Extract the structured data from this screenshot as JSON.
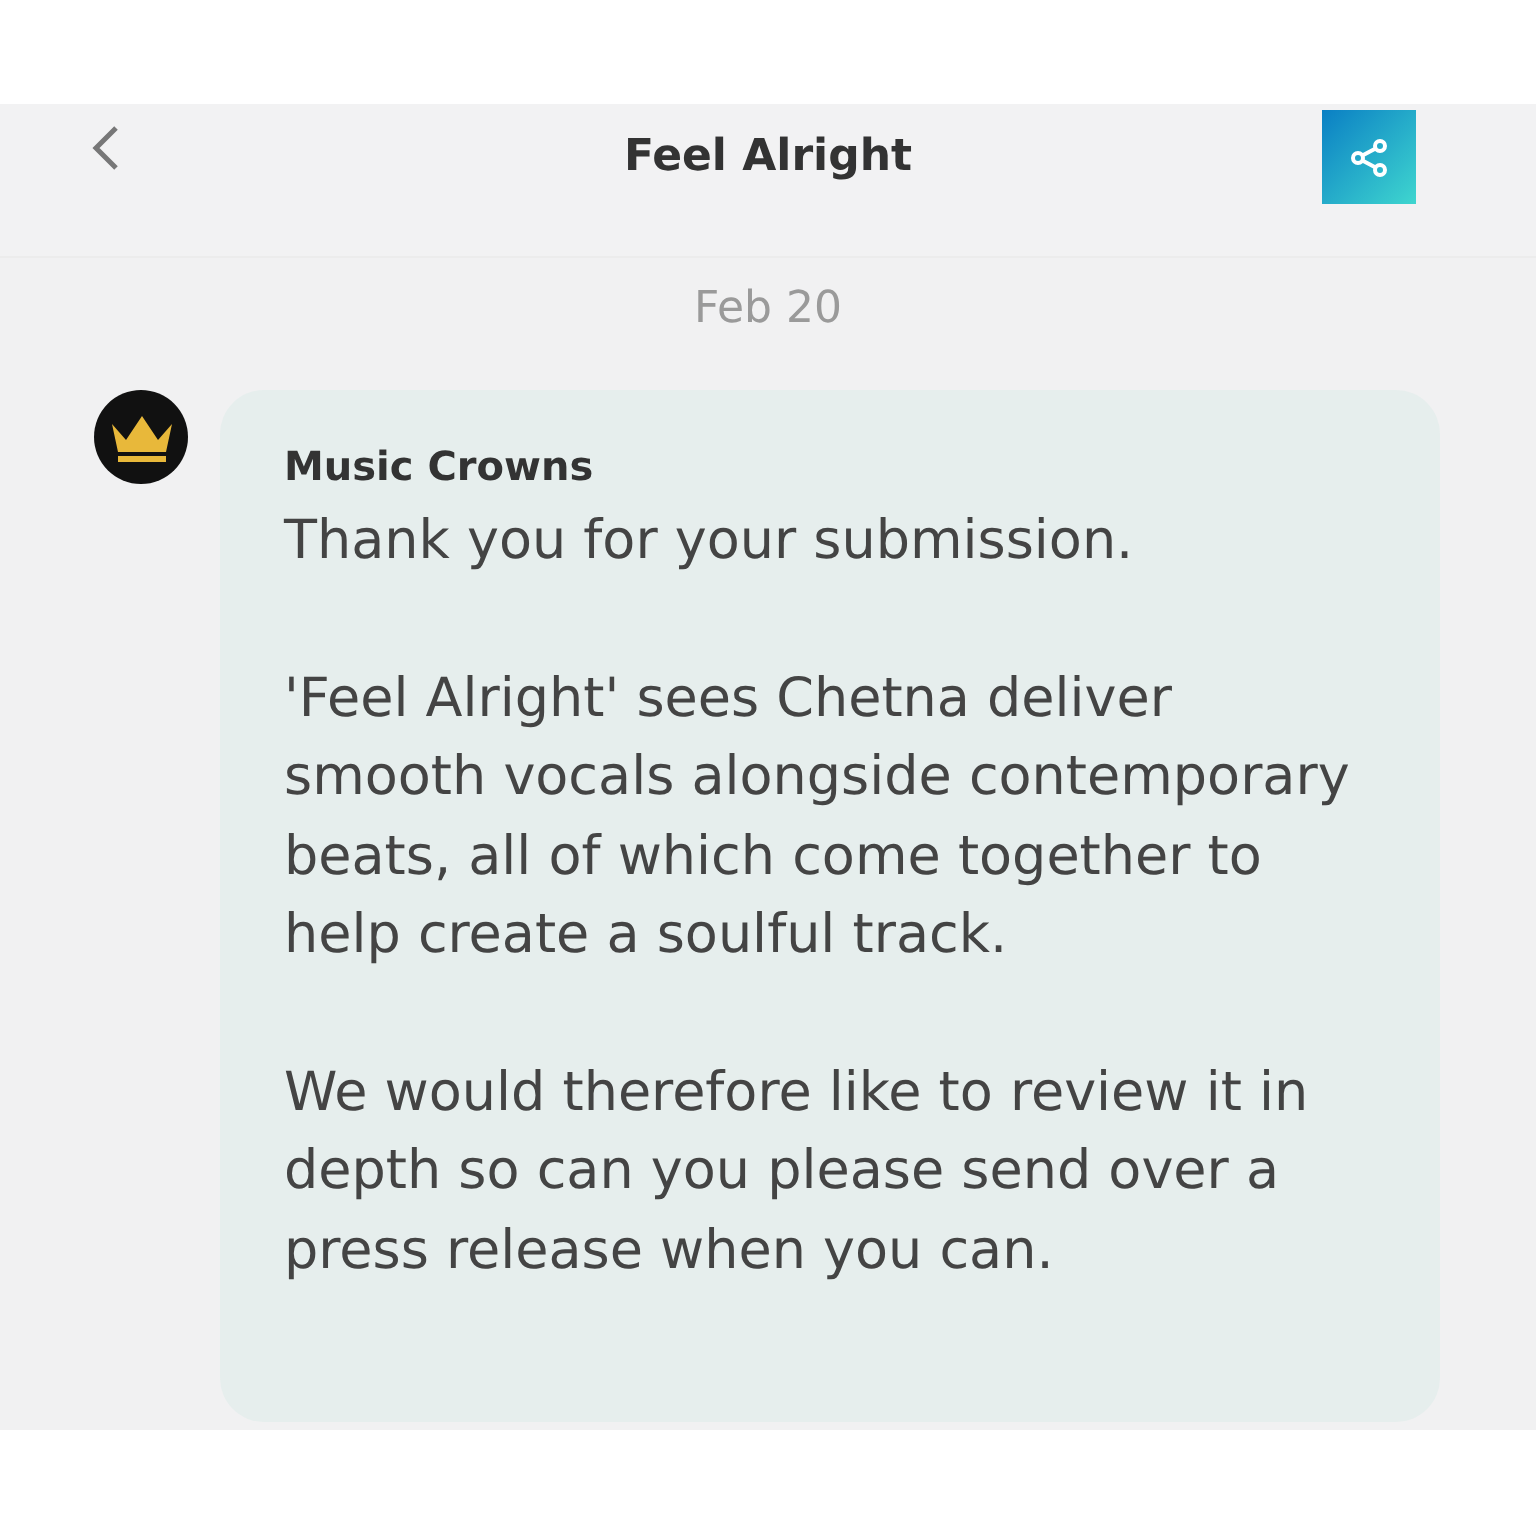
{
  "header": {
    "title": "Feel Alright"
  },
  "date": "Feb 20",
  "message": {
    "sender": "Music Crowns",
    "paragraphs": [
      "Thank you for your submission.",
      "'Feel Alright' sees Chetna deliver smooth vocals alongside contemporary beats, all of which come together to help create a soulful track.",
      "We would therefore like to review it in depth so can you please send over a press release when you can."
    ]
  }
}
